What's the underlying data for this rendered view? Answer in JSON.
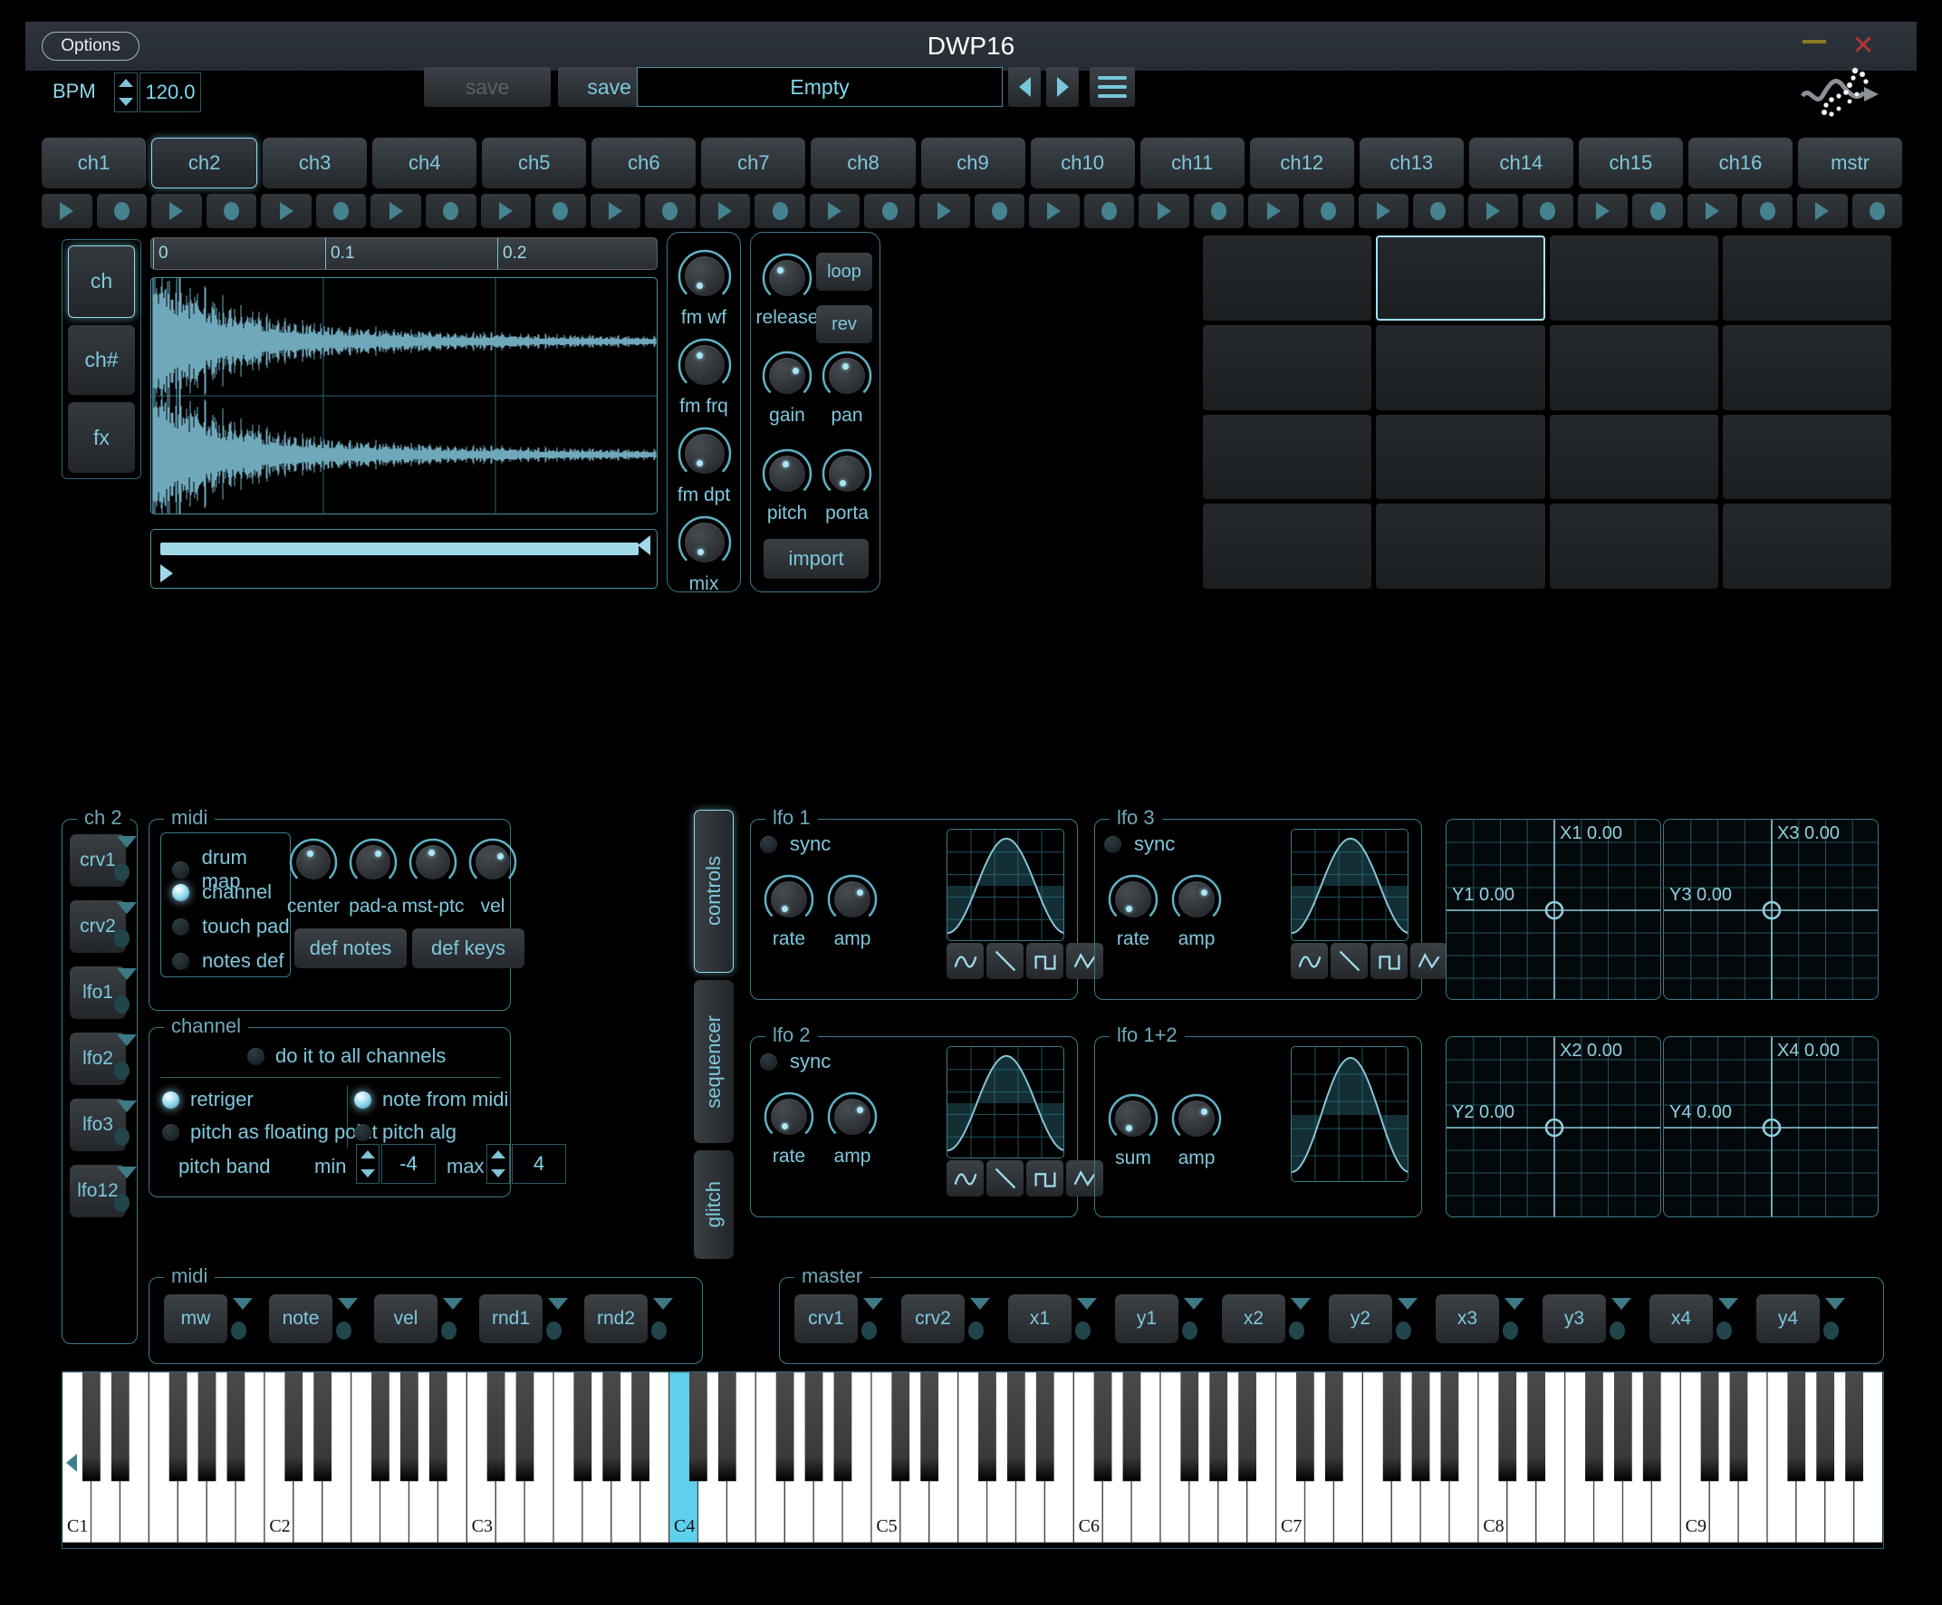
{
  "window": {
    "title": "DWP16",
    "options_label": "Options",
    "minimize_icon": "minimize-icon",
    "close_icon": "close-icon"
  },
  "transport": {
    "bpm_label": "BPM",
    "bpm_value": "120.0",
    "save_label": "save",
    "save_as_label": "save as",
    "preset_name": "Empty",
    "prev_icon": "left-arrow-icon",
    "next_icon": "right-arrow-icon",
    "menu_icon": "hamburger-menu-icon"
  },
  "channels": {
    "tabs": [
      "ch1",
      "ch2",
      "ch3",
      "ch4",
      "ch5",
      "ch6",
      "ch7",
      "ch8",
      "ch9",
      "ch10",
      "ch11",
      "ch12",
      "ch13",
      "ch14",
      "ch15",
      "ch16",
      "mstr"
    ],
    "selected": "ch2"
  },
  "modes": {
    "items": [
      "ch",
      "ch#",
      "fx"
    ],
    "selected": "ch"
  },
  "waveform": {
    "ruler_ticks": [
      "0",
      "0.1",
      "0.2"
    ],
    "accent": "#6fa8bb"
  },
  "fm_panel": {
    "knobs": [
      {
        "label": "fm wf",
        "angle": 210
      },
      {
        "label": "fm frq",
        "angle": 330
      },
      {
        "label": "fm dpt",
        "angle": 210
      },
      {
        "label": "mix",
        "angle": 205
      }
    ]
  },
  "amp_panel": {
    "knobs": [
      {
        "label": "release",
        "angle": 318
      },
      {
        "label": "gain",
        "angle": 60
      },
      {
        "label": "pan",
        "angle": 350
      },
      {
        "label": "pitch",
        "angle": 350
      },
      {
        "label": "porta",
        "angle": 205
      }
    ],
    "loop_label": "loop",
    "rev_label": "rev",
    "import_label": "import"
  },
  "pads": {
    "count": 16,
    "selected_index": 1
  },
  "channel_group": {
    "title": "ch 2",
    "side_buttons": [
      "crv1",
      "crv2",
      "lfo1",
      "lfo2",
      "lfo3",
      "lfo12"
    ]
  },
  "midi_panel": {
    "title": "midi",
    "radios": [
      {
        "label": "drum map",
        "on": false
      },
      {
        "label": "channel",
        "on": true
      },
      {
        "label": "touch pad",
        "on": false
      },
      {
        "label": "notes def",
        "on": false
      }
    ],
    "knobs": [
      {
        "label": "center",
        "angle": 340
      },
      {
        "label": "pad-a",
        "angle": 30
      },
      {
        "label": "mst-ptc",
        "angle": 350
      },
      {
        "label": "vel",
        "angle": 50
      }
    ],
    "buttons": [
      "def notes",
      "def keys"
    ]
  },
  "channel_panel": {
    "title": "channel",
    "all_channels": {
      "label": "do it to all channels",
      "on": false
    },
    "options": [
      {
        "label": "retriger",
        "on": true
      },
      {
        "label": "pitch as floating point",
        "on": false
      },
      {
        "label": "note from midi",
        "on": true
      },
      {
        "label": "pitch alg",
        "on": false
      }
    ],
    "pitch_band_label": "pitch band",
    "min_label": "min",
    "min_value": "-4",
    "max_label": "max",
    "max_value": "4"
  },
  "vtabs": {
    "items": [
      "controls",
      "sequencer",
      "glitch"
    ],
    "selected": "controls"
  },
  "lfos": [
    {
      "title": "lfo 1",
      "sync_label": "sync",
      "sync_on": false,
      "knobs": [
        {
          "label": "rate",
          "angle": 205
        },
        {
          "label": "amp",
          "angle": 50
        }
      ],
      "wave_buttons": [
        "sine-icon",
        "saw-down-icon",
        "square-icon",
        "triangle-icon"
      ],
      "wave": "sine"
    },
    {
      "title": "lfo 3",
      "sync_label": "sync",
      "sync_on": false,
      "knobs": [
        {
          "label": "rate",
          "angle": 205
        },
        {
          "label": "amp",
          "angle": 50
        }
      ],
      "wave_buttons": [
        "sine-icon",
        "saw-down-icon",
        "square-icon",
        "triangle-icon"
      ],
      "wave": "sine"
    },
    {
      "title": "lfo 2",
      "sync_label": "sync",
      "sync_on": false,
      "knobs": [
        {
          "label": "rate",
          "angle": 205
        },
        {
          "label": "amp",
          "angle": 50
        }
      ],
      "wave_buttons": [
        "sine-icon",
        "saw-down-icon",
        "square-icon",
        "triangle-icon"
      ],
      "wave": "sine"
    },
    {
      "title": "lfo 1+2",
      "sync_label": "",
      "sync_on": false,
      "knobs": [
        {
          "label": "sum",
          "angle": 205
        },
        {
          "label": "amp",
          "angle": 50
        }
      ],
      "wave_buttons": [],
      "wave": "sine"
    }
  ],
  "xypads": [
    {
      "x_label": "X1",
      "x_value": "0.00",
      "y_label": "Y1",
      "y_value": "0.00"
    },
    {
      "x_label": "X3",
      "x_value": "0.00",
      "y_label": "Y3",
      "y_value": "0.00"
    },
    {
      "x_label": "X2",
      "x_value": "0.00",
      "y_label": "Y2",
      "y_value": "0.00"
    },
    {
      "x_label": "X4",
      "x_value": "0.00",
      "y_label": "Y4",
      "y_value": "0.00"
    }
  ],
  "bottom_midi": {
    "title": "midi",
    "buttons": [
      "mw",
      "note",
      "vel",
      "rnd1",
      "rnd2"
    ]
  },
  "bottom_master": {
    "title": "master",
    "buttons": [
      "crv1",
      "crv2",
      "x1",
      "y1",
      "x2",
      "y2",
      "x3",
      "y3",
      "x4",
      "y4"
    ]
  },
  "piano": {
    "octave_labels": [
      "C1",
      "C2",
      "C3",
      "C4",
      "C5",
      "C6",
      "C7",
      "C8",
      "C9"
    ],
    "highlighted_note": "C4",
    "scroll_left_icon": "left-arrow-icon"
  },
  "colors": {
    "accent": "#8fd6e8",
    "panel_border": "#3c7a88",
    "led_on": "#9fe0f4",
    "highlight_key": "#5fd0ec"
  }
}
